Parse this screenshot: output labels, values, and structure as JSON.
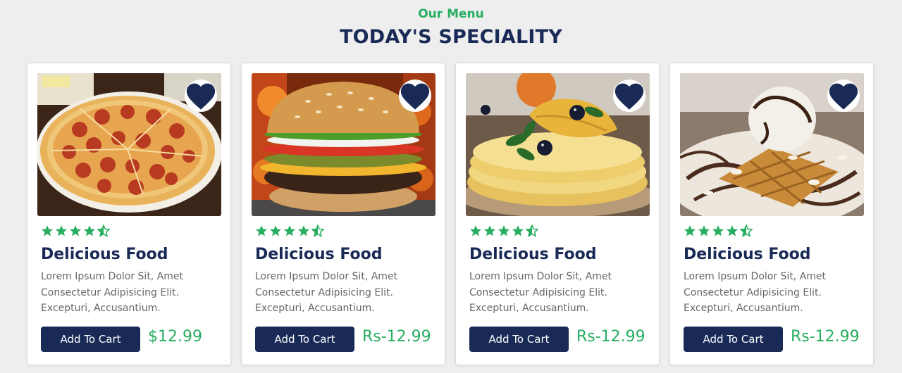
{
  "section": {
    "subtitle": "Our Menu",
    "title": "TODAY'S SPECIALITY"
  },
  "colors": {
    "accent_green": "#27ae60",
    "navy": "#192a56",
    "background": "#eeeeef"
  },
  "rating": {
    "value": 4.5,
    "max": 5
  },
  "cards": [
    {
      "image": "pepperoni-pizza",
      "name": "Delicious Food",
      "description": "Lorem Ipsum Dolor Sit, Amet Consectetur Adipisicing Elit. Excepturi, Accusantium.",
      "button": "Add To Cart",
      "price": "$12.99",
      "favorite_icon": "heart-icon"
    },
    {
      "image": "cheeseburger",
      "name": "Delicious Food",
      "description": "Lorem Ipsum Dolor Sit, Amet Consectetur Adipisicing Elit. Excepturi, Accusantium.",
      "button": "Add To Cart",
      "price": "Rs-12.99",
      "favorite_icon": "heart-icon"
    },
    {
      "image": "crepes-with-blueberries",
      "name": "Delicious Food",
      "description": "Lorem Ipsum Dolor Sit, Amet Consectetur Adipisicing Elit. Excepturi, Accusantium.",
      "button": "Add To Cart",
      "price": "Rs-12.99",
      "favorite_icon": "heart-icon"
    },
    {
      "image": "waffle-with-ice-cream",
      "name": "Delicious Food",
      "description": "Lorem Ipsum Dolor Sit, Amet Consectetur Adipisicing Elit. Excepturi, Accusantium.",
      "button": "Add To Cart",
      "price": "Rs-12.99",
      "favorite_icon": "heart-icon"
    }
  ]
}
